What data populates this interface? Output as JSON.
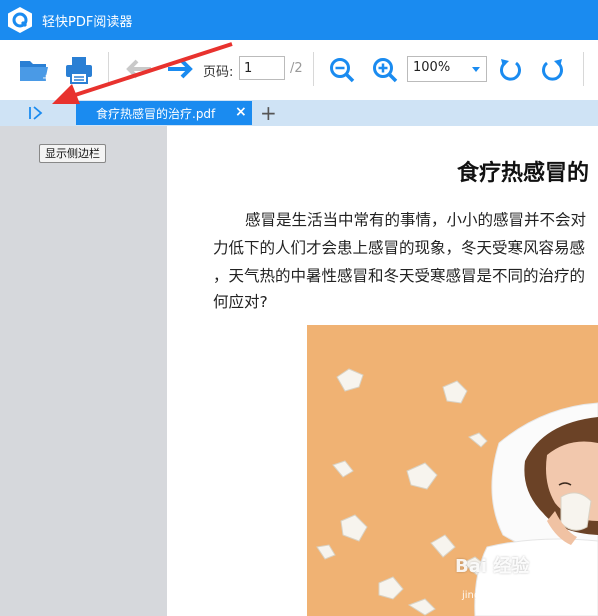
{
  "app": {
    "title": "轻快PDF阅读器"
  },
  "toolbar": {
    "page_label": "页码:",
    "page_value": "1",
    "page_total": "/2",
    "zoom_value": "100%",
    "icons": [
      "open-folder-icon",
      "print-icon",
      "back-arrow-icon",
      "forward-arrow-icon",
      "zoom-out-icon",
      "zoom-in-icon",
      "rotate-left-icon",
      "rotate-right-icon"
    ]
  },
  "tabs": [
    {
      "label": "食疗热感冒的治疗.pdf",
      "active": true
    }
  ],
  "tab_add_label": "+",
  "tab_close_label": "×",
  "sidebar": {
    "show_button_label": "显示侧边栏"
  },
  "document": {
    "title": "食疗热感冒的",
    "lines": [
      "感冒是生活当中常有的事情，小小的感冒并不会对",
      "力低下的人们才会患上感冒的现象，冬天受寒风容易感",
      "，天气热的中暑性感冒和冬天受寒感冒是不同的治疗的",
      "何应对?"
    ]
  },
  "watermark": {
    "text": "Bai 经验",
    "sub": "jingyan.baidu.com"
  },
  "colors": {
    "accent": "#1a8bf0",
    "tabbar": "#cfe3f5",
    "sidebar": "#d6d8dc",
    "arrow": "#e8322e"
  }
}
